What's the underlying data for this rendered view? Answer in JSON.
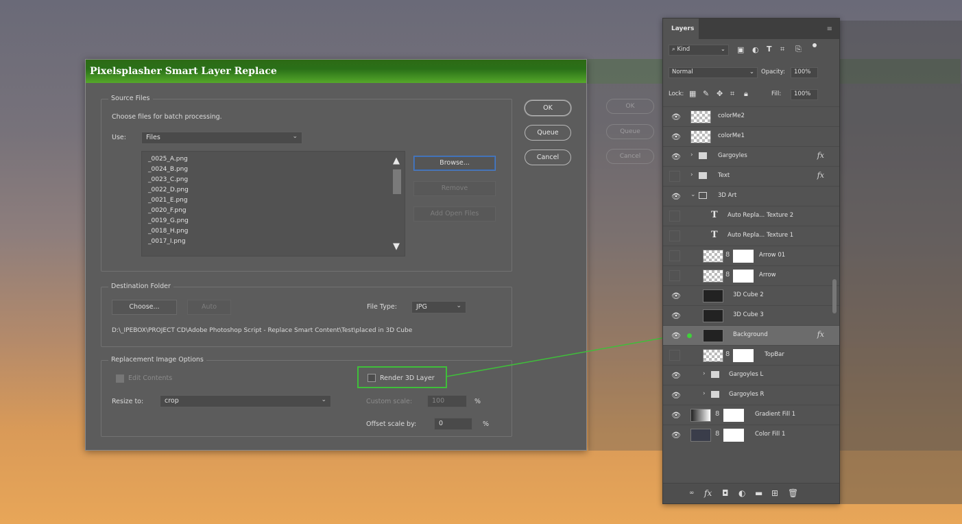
{
  "dialog": {
    "title": "Pixelsplasher Smart Layer Replace",
    "source": {
      "group_title": "Source Files",
      "instructions": "Choose files for batch processing.",
      "use_label": "Use:",
      "use_value": "Files",
      "files": [
        "_0025_A.png",
        "_0024_B.png",
        "_0023_C.png",
        "_0022_D.png",
        "_0021_E.png",
        "_0020_F.png",
        "_0019_G.png",
        "_0018_H.png",
        "_0017_I.png"
      ],
      "browse": "Browse...",
      "remove": "Remove",
      "add_open": "Add Open Files"
    },
    "buttons": {
      "ok": "OK",
      "queue": "Queue",
      "cancel": "Cancel"
    },
    "destination": {
      "group_title": "Destination Folder",
      "choose": "Choose...",
      "auto": "Auto",
      "filetype_label": "File Type:",
      "filetype_value": "JPG",
      "path": "D:\\_IPEBOX\\PROJECT CD\\Adobe Photoshop Script - Replace Smart Content\\Test\\placed in 3D Cube"
    },
    "replacement": {
      "group_title": "Replacement Image Options",
      "edit_contents": "Edit Contents",
      "render_3d": "Render 3D Layer",
      "resize_label": "Resize to:",
      "resize_value": "crop",
      "custom_scale_label": "Custom scale:",
      "custom_scale_value": "100",
      "offset_label": "Offset scale by:",
      "offset_value": "0",
      "percent": "%"
    }
  },
  "layers_panel": {
    "tab": "Layers",
    "kind": "Kind",
    "blend_mode": "Normal",
    "opacity_label": "Opacity:",
    "opacity_value": "100%",
    "lock_label": "Lock:",
    "fill_label": "Fill:",
    "fill_value": "100%",
    "layers": [
      {
        "name": "colorMe2",
        "visible": true
      },
      {
        "name": "colorMe1",
        "visible": true
      },
      {
        "name": "Gargoyles",
        "visible": true,
        "fx": true
      },
      {
        "name": "Text",
        "visible": false,
        "fx": true
      },
      {
        "name": "3D Art",
        "visible": true
      },
      {
        "name": "Auto Repla... Texture 2",
        "visible": false
      },
      {
        "name": "Auto Repla... Texture 1",
        "visible": false
      },
      {
        "name": "Arrow 01",
        "visible": false
      },
      {
        "name": "Arrow",
        "visible": false
      },
      {
        "name": "3D Cube 2",
        "visible": true
      },
      {
        "name": "3D Cube 3",
        "visible": true
      },
      {
        "name": "Background",
        "visible": true,
        "fx": true,
        "selected": true
      },
      {
        "name": "TopBar",
        "visible": false
      },
      {
        "name": "Gargoyles L",
        "visible": true
      },
      {
        "name": "Gargoyles R",
        "visible": true
      },
      {
        "name": "Gradient Fill 1",
        "visible": true
      },
      {
        "name": "Color Fill 1",
        "visible": true
      }
    ]
  },
  "ghost": {
    "ok": "OK",
    "queue": "Queue",
    "cancel": "Cancel"
  },
  "colors": {
    "title_green": "#2d6a15",
    "highlight_green": "#3fbf3a"
  }
}
